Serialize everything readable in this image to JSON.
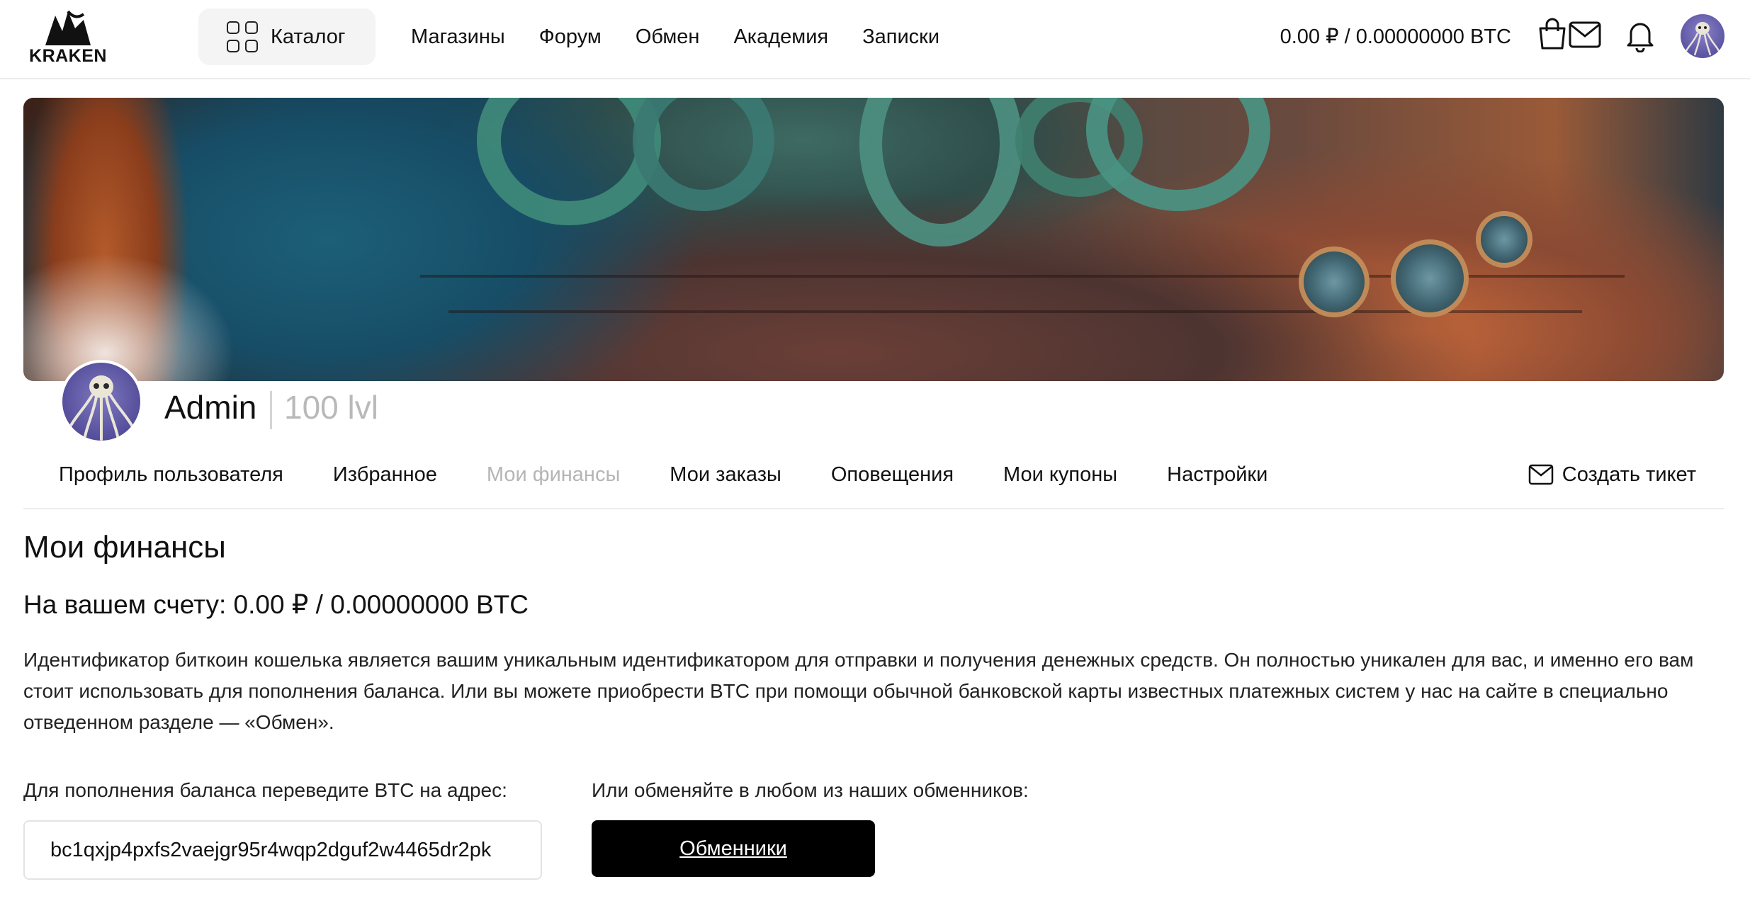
{
  "logo": {
    "text": "KRAKEN"
  },
  "header": {
    "catalog_label": "Каталог",
    "nav": [
      "Магазины",
      "Форум",
      "Обмен",
      "Академия",
      "Записки"
    ],
    "balance": "0.00 ₽ / 0.00000000 BTC"
  },
  "profile": {
    "name": "Admin",
    "level": "100 lvl"
  },
  "tabs": [
    {
      "label": "Профиль пользователя",
      "active": false
    },
    {
      "label": "Избранное",
      "active": false
    },
    {
      "label": "Мои финансы",
      "active": true
    },
    {
      "label": "Мои заказы",
      "active": false
    },
    {
      "label": "Оповещения",
      "active": false
    },
    {
      "label": "Мои купоны",
      "active": false
    },
    {
      "label": "Настройки",
      "active": false
    }
  ],
  "ticket_label": "Создать тикет",
  "finances": {
    "title": "Мои финансы",
    "balance_prefix": "На вашем счету:",
    "balance_value": "0.00 ₽ / 0.00000000 BTC",
    "description": "Идентификатор биткоин кошелька является вашим уникальным идентификатором для отправки и получения денежных средств. Он полностью уникален для вас, и именно его вам стоит использовать для пополнения баланса. Или вы можете приобрести BTC при помощи обычной банковской карты известных платежных систем у нас на сайте в специально отведенном разделе — «Обмен».",
    "deposit_label": "Для пополнения баланса переведите BTC на адрес:",
    "address": "bc1qxjp4pxfs2vaejgr95r4wqp2dguf2w4465dr2pk",
    "exchange_label": "Или обменяйте в любом из наших обменников:",
    "exchange_button": "Обменники"
  },
  "icons": {
    "catalog": "grid-icon",
    "cart": "shopping-bag-icon",
    "mail": "envelope-icon",
    "notifications": "bell-icon",
    "ticket": "envelope-icon"
  },
  "colors": {
    "active_tab": "#b5b5b5",
    "button_bg": "#000000",
    "avatar_bg": "#5c55a3"
  }
}
